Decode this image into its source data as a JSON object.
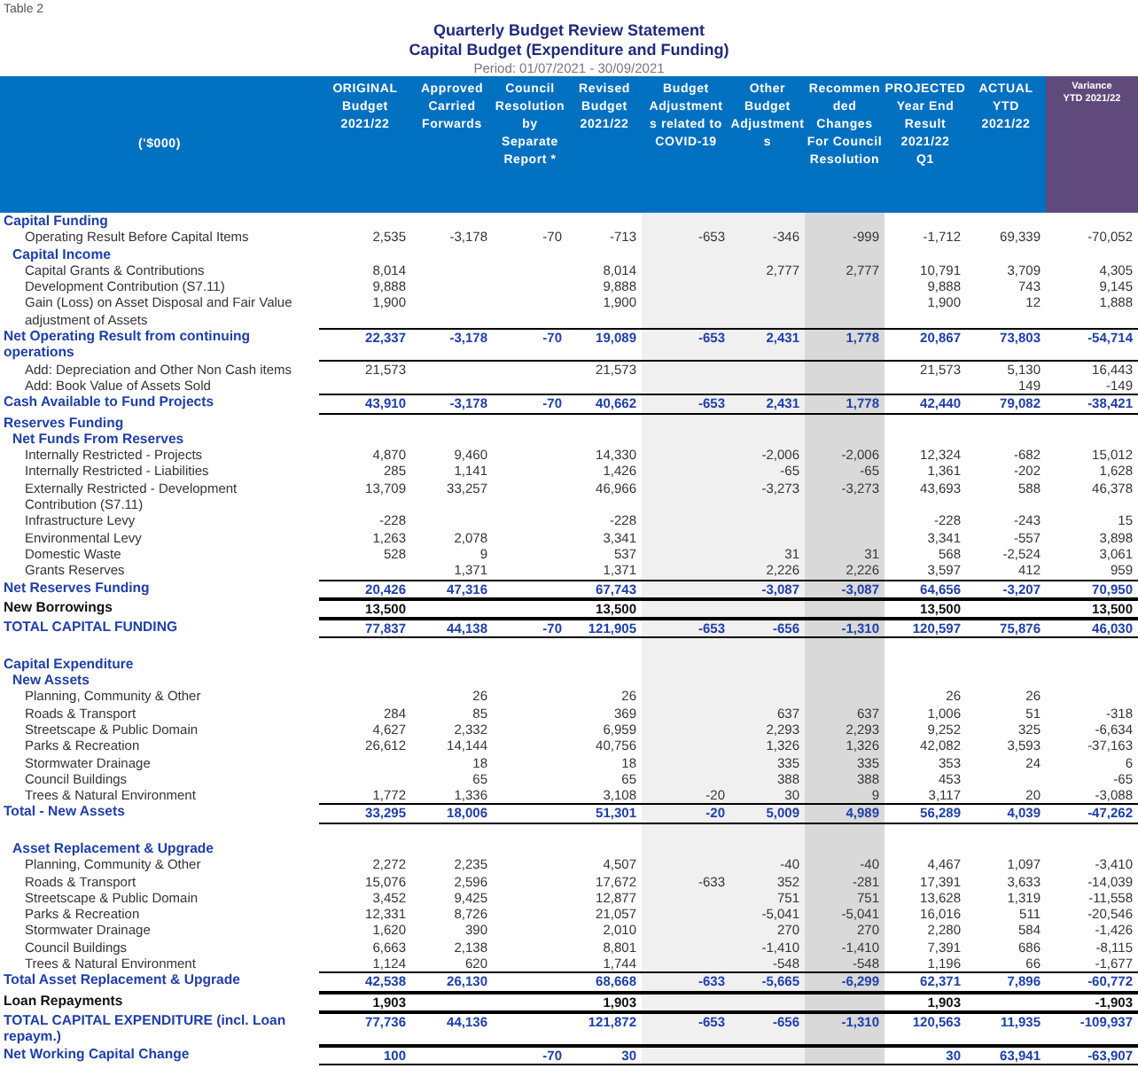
{
  "caption": "Table 2",
  "title": [
    "Quarterly Budget Review Statement",
    "Capital Budget (Expenditure and Funding)"
  ],
  "period": "Period: 01/07/2021 - 30/09/2021",
  "unit_header": "('$000)",
  "columns": [
    {
      "lines": [
        "ORIGINAL",
        "Budget",
        "2021/22"
      ],
      "kind": "plain"
    },
    {
      "lines": [
        "Approved",
        "Carried",
        "Forwards"
      ],
      "kind": "plain"
    },
    {
      "lines": [
        "Council",
        "Resolution",
        "by",
        "Separate",
        "Report *"
      ],
      "kind": "plain"
    },
    {
      "lines": [
        "Revised",
        "Budget",
        "2021/22"
      ],
      "kind": "plain"
    },
    {
      "lines": [
        "Budget",
        "Adjustment",
        "s related to",
        "COVID-19"
      ],
      "kind": "light"
    },
    {
      "lines": [
        "Other",
        "Budget",
        "Adjustment",
        "s"
      ],
      "kind": "light"
    },
    {
      "lines": [
        "Recommen",
        "ded",
        "Changes",
        "For Council",
        "Resolution"
      ],
      "kind": "dark"
    },
    {
      "lines": [
        "PROJECTED",
        "Year End",
        "Result",
        "2021/22",
        "Q1"
      ],
      "kind": "plain"
    },
    {
      "lines": [
        "ACTUAL",
        "YTD",
        "2021/22"
      ],
      "kind": "plain"
    },
    {
      "lines": [
        "Variance",
        "YTD 2021/22"
      ],
      "kind": "variance"
    }
  ],
  "rows": [
    {
      "kind": "section",
      "label": "Capital Funding"
    },
    {
      "kind": "item",
      "label": "Operating Result Before Capital Items",
      "values": {
        "original": "2,535",
        "carried": "-3,178",
        "council": "-70",
        "revised": "-713",
        "covid": "-653",
        "other": "-346",
        "recommended": "-999",
        "projected": "-1,712",
        "actual": "69,339",
        "variance": "-70,052"
      }
    },
    {
      "kind": "subsection",
      "label": "Capital Income"
    },
    {
      "kind": "item",
      "label": "Capital Grants & Contributions",
      "values": {
        "original": "8,014",
        "revised": "8,014",
        "other": "2,777",
        "recommended": "2,777",
        "projected": "10,791",
        "actual": "3,709",
        "variance": "4,305"
      }
    },
    {
      "kind": "item",
      "label": "Development Contribution (S7.11)",
      "values": {
        "original": "9,888",
        "revised": "9,888",
        "projected": "9,888",
        "actual": "743",
        "variance": "9,145"
      }
    },
    {
      "kind": "item",
      "label": "Gain (Loss) on Asset Disposal and Fair Value adjustment of Assets",
      "values": {
        "original": "1,900",
        "revised": "1,900",
        "projected": "1,900",
        "actual": "12",
        "variance": "1,888"
      }
    },
    {
      "kind": "total",
      "label": "Net Operating Result from continuing operations",
      "values": {
        "original": "22,337",
        "carried": "-3,178",
        "council": "-70",
        "revised": "19,089",
        "covid": "-653",
        "other": "2,431",
        "recommended": "1,778",
        "projected": "20,867",
        "actual": "73,803",
        "variance": "-54,714"
      }
    },
    {
      "kind": "item",
      "label": "Add: Depreciation and Other Non Cash items",
      "values": {
        "original": "21,573",
        "revised": "21,573",
        "projected": "21,573",
        "actual": "5,130",
        "variance": "16,443"
      }
    },
    {
      "kind": "item",
      "label": "Add: Book Value of Assets Sold",
      "values": {
        "actual": "149",
        "variance": "-149"
      }
    },
    {
      "kind": "total",
      "label": "Cash Available to Fund Projects",
      "values": {
        "original": "43,910",
        "carried": "-3,178",
        "council": "-70",
        "revised": "40,662",
        "covid": "-653",
        "other": "2,431",
        "recommended": "1,778",
        "projected": "42,440",
        "actual": "79,082",
        "variance": "-38,421"
      }
    },
    {
      "kind": "section",
      "label": "Reserves Funding"
    },
    {
      "kind": "subsection",
      "label": "Net Funds From Reserves"
    },
    {
      "kind": "item",
      "label": "Internally Restricted - Projects",
      "values": {
        "original": "4,870",
        "carried": "9,460",
        "revised": "14,330",
        "other": "-2,006",
        "recommended": "-2,006",
        "projected": "12,324",
        "actual": "-682",
        "variance": "15,012"
      }
    },
    {
      "kind": "item",
      "label": "Internally Restricted - Liabilities",
      "values": {
        "original": "285",
        "carried": "1,141",
        "revised": "1,426",
        "other": "-65",
        "recommended": "-65",
        "projected": "1,361",
        "actual": "-202",
        "variance": "1,628"
      }
    },
    {
      "kind": "item",
      "label": "Externally Restricted - Development Contribution (S7.11)",
      "values": {
        "original": "13,709",
        "carried": "33,257",
        "revised": "46,966",
        "other": "-3,273",
        "recommended": "-3,273",
        "projected": "43,693",
        "actual": "588",
        "variance": "46,378"
      }
    },
    {
      "kind": "item",
      "label": "Infrastructure Levy",
      "values": {
        "original": "-228",
        "revised": "-228",
        "projected": "-228",
        "actual": "-243",
        "variance": "15"
      }
    },
    {
      "kind": "item",
      "label": "Environmental Levy",
      "values": {
        "original": "1,263",
        "carried": "2,078",
        "revised": "3,341",
        "projected": "3,341",
        "actual": "-557",
        "variance": "3,898"
      }
    },
    {
      "kind": "item",
      "label": "Domestic Waste",
      "values": {
        "original": "528",
        "carried": "9",
        "revised": "537",
        "other": "31",
        "recommended": "31",
        "projected": "568",
        "actual": "-2,524",
        "variance": "3,061"
      }
    },
    {
      "kind": "item",
      "label": "Grants Reserves",
      "values": {
        "carried": "1,371",
        "revised": "1,371",
        "other": "2,226",
        "recommended": "2,226",
        "projected": "3,597",
        "actual": "412",
        "variance": "959"
      }
    },
    {
      "kind": "total",
      "label": "Net Reserves Funding",
      "values": {
        "original": "20,426",
        "carried": "47,316",
        "revised": "67,743",
        "other": "-3,087",
        "recommended": "-3,087",
        "projected": "64,656",
        "actual": "-3,207",
        "variance": "70,950"
      }
    },
    {
      "kind": "plain_total",
      "label": "New Borrowings",
      "values": {
        "original": "13,500",
        "revised": "13,500",
        "projected": "13,500",
        "variance": "13,500"
      }
    },
    {
      "kind": "total",
      "label": "TOTAL CAPITAL FUNDING",
      "values": {
        "original": "77,837",
        "carried": "44,138",
        "council": "-70",
        "revised": "121,905",
        "covid": "-653",
        "other": "-656",
        "recommended": "-1,310",
        "projected": "120,597",
        "actual": "75,876",
        "variance": "46,030"
      }
    },
    {
      "kind": "blank"
    },
    {
      "kind": "section",
      "label": "Capital Expenditure"
    },
    {
      "kind": "subsection",
      "label": "New Assets"
    },
    {
      "kind": "item",
      "label": "Planning, Community & Other",
      "values": {
        "carried": "26",
        "revised": "26",
        "projected": "26",
        "actual": "26"
      }
    },
    {
      "kind": "item",
      "label": "Roads & Transport",
      "values": {
        "original": "284",
        "carried": "85",
        "revised": "369",
        "other": "637",
        "recommended": "637",
        "projected": "1,006",
        "actual": "51",
        "variance": "-318"
      }
    },
    {
      "kind": "item",
      "label": "Streetscape & Public Domain",
      "values": {
        "original": "4,627",
        "carried": "2,332",
        "revised": "6,959",
        "other": "2,293",
        "recommended": "2,293",
        "projected": "9,252",
        "actual": "325",
        "variance": "-6,634"
      }
    },
    {
      "kind": "item",
      "label": "Parks & Recreation",
      "values": {
        "original": "26,612",
        "carried": "14,144",
        "revised": "40,756",
        "other": "1,326",
        "recommended": "1,326",
        "projected": "42,082",
        "actual": "3,593",
        "variance": "-37,163"
      }
    },
    {
      "kind": "item",
      "label": "Stormwater Drainage",
      "values": {
        "carried": "18",
        "revised": "18",
        "other": "335",
        "recommended": "335",
        "projected": "353",
        "actual": "24",
        "variance": "6"
      }
    },
    {
      "kind": "item",
      "label": "Council Buildings",
      "values": {
        "carried": "65",
        "revised": "65",
        "other": "388",
        "recommended": "388",
        "projected": "453",
        "variance": "-65"
      }
    },
    {
      "kind": "item",
      "label": "Trees & Natural Environment",
      "values": {
        "original": "1,772",
        "carried": "1,336",
        "revised": "3,108",
        "covid": "-20",
        "other": "30",
        "recommended": "9",
        "projected": "3,117",
        "actual": "20",
        "variance": "-3,088"
      }
    },
    {
      "kind": "total",
      "label": "Total - New Assets",
      "values": {
        "original": "33,295",
        "carried": "18,006",
        "revised": "51,301",
        "covid": "-20",
        "other": "5,009",
        "recommended": "4,989",
        "projected": "56,289",
        "actual": "4,039",
        "variance": "-47,262"
      }
    },
    {
      "kind": "blank"
    },
    {
      "kind": "subsection",
      "label": "Asset Replacement & Upgrade"
    },
    {
      "kind": "item",
      "label": "Planning, Community & Other",
      "values": {
        "original": "2,272",
        "carried": "2,235",
        "revised": "4,507",
        "other": "-40",
        "recommended": "-40",
        "projected": "4,467",
        "actual": "1,097",
        "variance": "-3,410"
      }
    },
    {
      "kind": "item",
      "label": "Roads & Transport",
      "values": {
        "original": "15,076",
        "carried": "2,596",
        "revised": "17,672",
        "covid": "-633",
        "other": "352",
        "recommended": "-281",
        "projected": "17,391",
        "actual": "3,633",
        "variance": "-14,039"
      }
    },
    {
      "kind": "item",
      "label": "Streetscape & Public Domain",
      "values": {
        "original": "3,452",
        "carried": "9,425",
        "revised": "12,877",
        "other": "751",
        "recommended": "751",
        "projected": "13,628",
        "actual": "1,319",
        "variance": "-11,558"
      }
    },
    {
      "kind": "item",
      "label": "Parks & Recreation",
      "values": {
        "original": "12,331",
        "carried": "8,726",
        "revised": "21,057",
        "other": "-5,041",
        "recommended": "-5,041",
        "projected": "16,016",
        "actual": "511",
        "variance": "-20,546"
      }
    },
    {
      "kind": "item",
      "label": "Stormwater Drainage",
      "values": {
        "original": "1,620",
        "carried": "390",
        "revised": "2,010",
        "other": "270",
        "recommended": "270",
        "projected": "2,280",
        "actual": "584",
        "variance": "-1,426"
      }
    },
    {
      "kind": "item",
      "label": "Council Buildings",
      "values": {
        "original": "6,663",
        "carried": "2,138",
        "revised": "8,801",
        "other": "-1,410",
        "recommended": "-1,410",
        "projected": "7,391",
        "actual": "686",
        "variance": "-8,115"
      }
    },
    {
      "kind": "item",
      "label": "Trees & Natural Environment",
      "values": {
        "original": "1,124",
        "carried": "620",
        "revised": "1,744",
        "other": "-548",
        "recommended": "-548",
        "projected": "1,196",
        "actual": "66",
        "variance": "-1,677"
      }
    },
    {
      "kind": "total",
      "label": "Total Asset Replacement & Upgrade",
      "values": {
        "original": "42,538",
        "carried": "26,130",
        "revised": "68,668",
        "covid": "-633",
        "other": "-5,665",
        "recommended": "-6,299",
        "projected": "62,371",
        "actual": "7,896",
        "variance": "-60,772"
      }
    },
    {
      "kind": "plain_total",
      "label": "Loan Repayments",
      "values": {
        "original": "1,903",
        "revised": "1,903",
        "projected": "1,903",
        "variance": "-1,903"
      }
    },
    {
      "kind": "total",
      "label": "TOTAL CAPITAL EXPENDITURE (incl. Loan repaym.)",
      "values": {
        "original": "77,736",
        "carried": "44,136",
        "revised": "121,872",
        "covid": "-653",
        "other": "-656",
        "recommended": "-1,310",
        "projected": "120,563",
        "actual": "11,935",
        "variance": "-109,937"
      }
    },
    {
      "kind": "total",
      "label": "Net Working Capital Change",
      "values": {
        "original": "100",
        "council": "-70",
        "revised": "30",
        "projected": "30",
        "actual": "63,941",
        "variance": "-63,907"
      }
    }
  ]
}
